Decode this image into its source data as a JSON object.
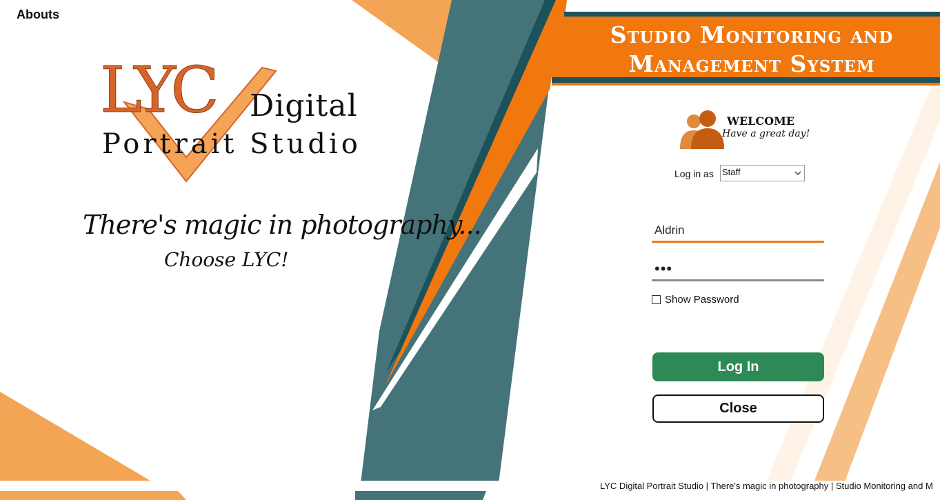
{
  "nav": {
    "abouts": "Abouts"
  },
  "brand": {
    "logo_text": "LYC Digital Portrait Studio",
    "tagline": "There's magic in photography...",
    "cta": "Choose LYC!"
  },
  "header": {
    "title_line1": "Studio Monitoring and",
    "title_line2": "Management System"
  },
  "welcome": {
    "title": "WELCOME",
    "subtitle": "Have a great day!"
  },
  "login": {
    "role_label": "Log in as",
    "role_value": "Staff",
    "username_value": "Aldrin",
    "password_mask": "•••",
    "show_password_label": "Show Password",
    "show_password_checked": false,
    "login_button": "Log In",
    "close_button": "Close"
  },
  "footer": {
    "text": "LYC Digital Portrait Studio  |  There's magic in photography  |  Studio Monitoring and M"
  },
  "colors": {
    "orange": "#f0780f",
    "teal": "#45737a",
    "dark_teal": "#1c525c",
    "light_orange": "#f4a455",
    "green": "#2d8a56"
  }
}
